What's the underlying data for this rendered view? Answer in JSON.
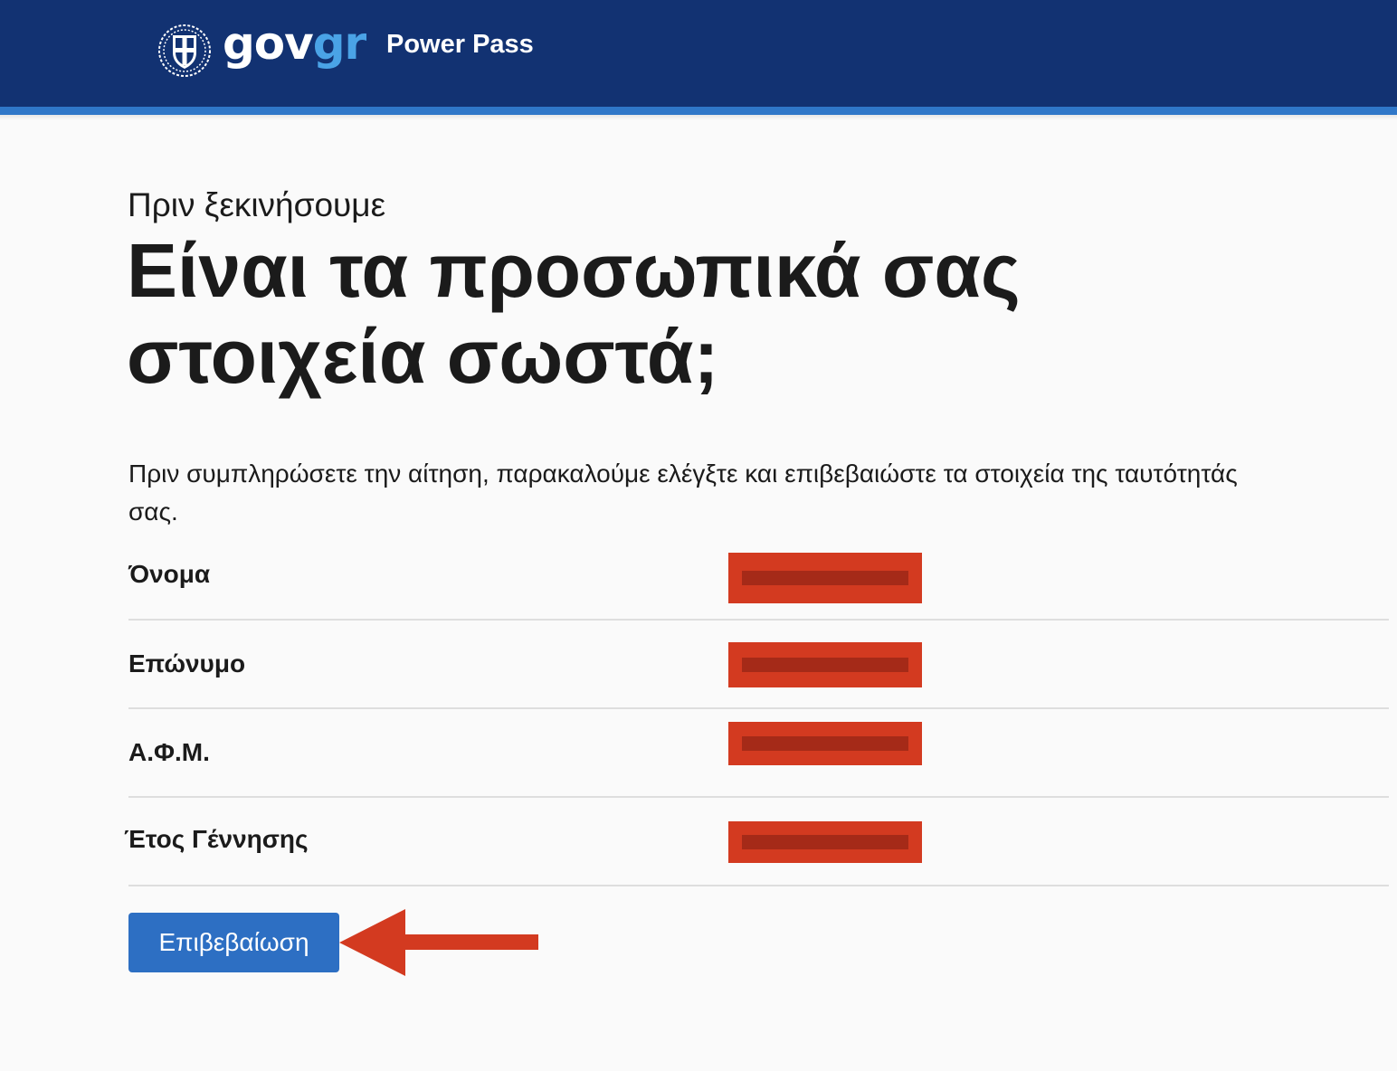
{
  "header": {
    "logo_gov": "gov",
    "logo_gr": "gr",
    "app_name": "Power Pass",
    "colors": {
      "background": "#123272",
      "stripe": "#2f77c8",
      "logo_accent": "#4aa3e6"
    }
  },
  "main": {
    "caption": "Πριν ξεκινήσουμε",
    "title": "Είναι τα προσωπικά σας στοιχεία σωστά;",
    "intro": "Πριν συμπληρώσετε την αίτηση, παρακαλούμε ελέγξτε και επιβεβαιώστε τα στοιχεία της ταυτότητάς σας.",
    "fields": [
      {
        "label": "Όνομα"
      },
      {
        "label": "Επώνυμο"
      },
      {
        "label": "Α.Φ.Μ."
      },
      {
        "label": "Έτος Γέννησης"
      }
    ],
    "confirm_button": "Επιβεβαίωση",
    "colors": {
      "button": "#2d6fc3",
      "redaction": "#d33a20",
      "annotation_arrow": "#d33a20"
    }
  }
}
